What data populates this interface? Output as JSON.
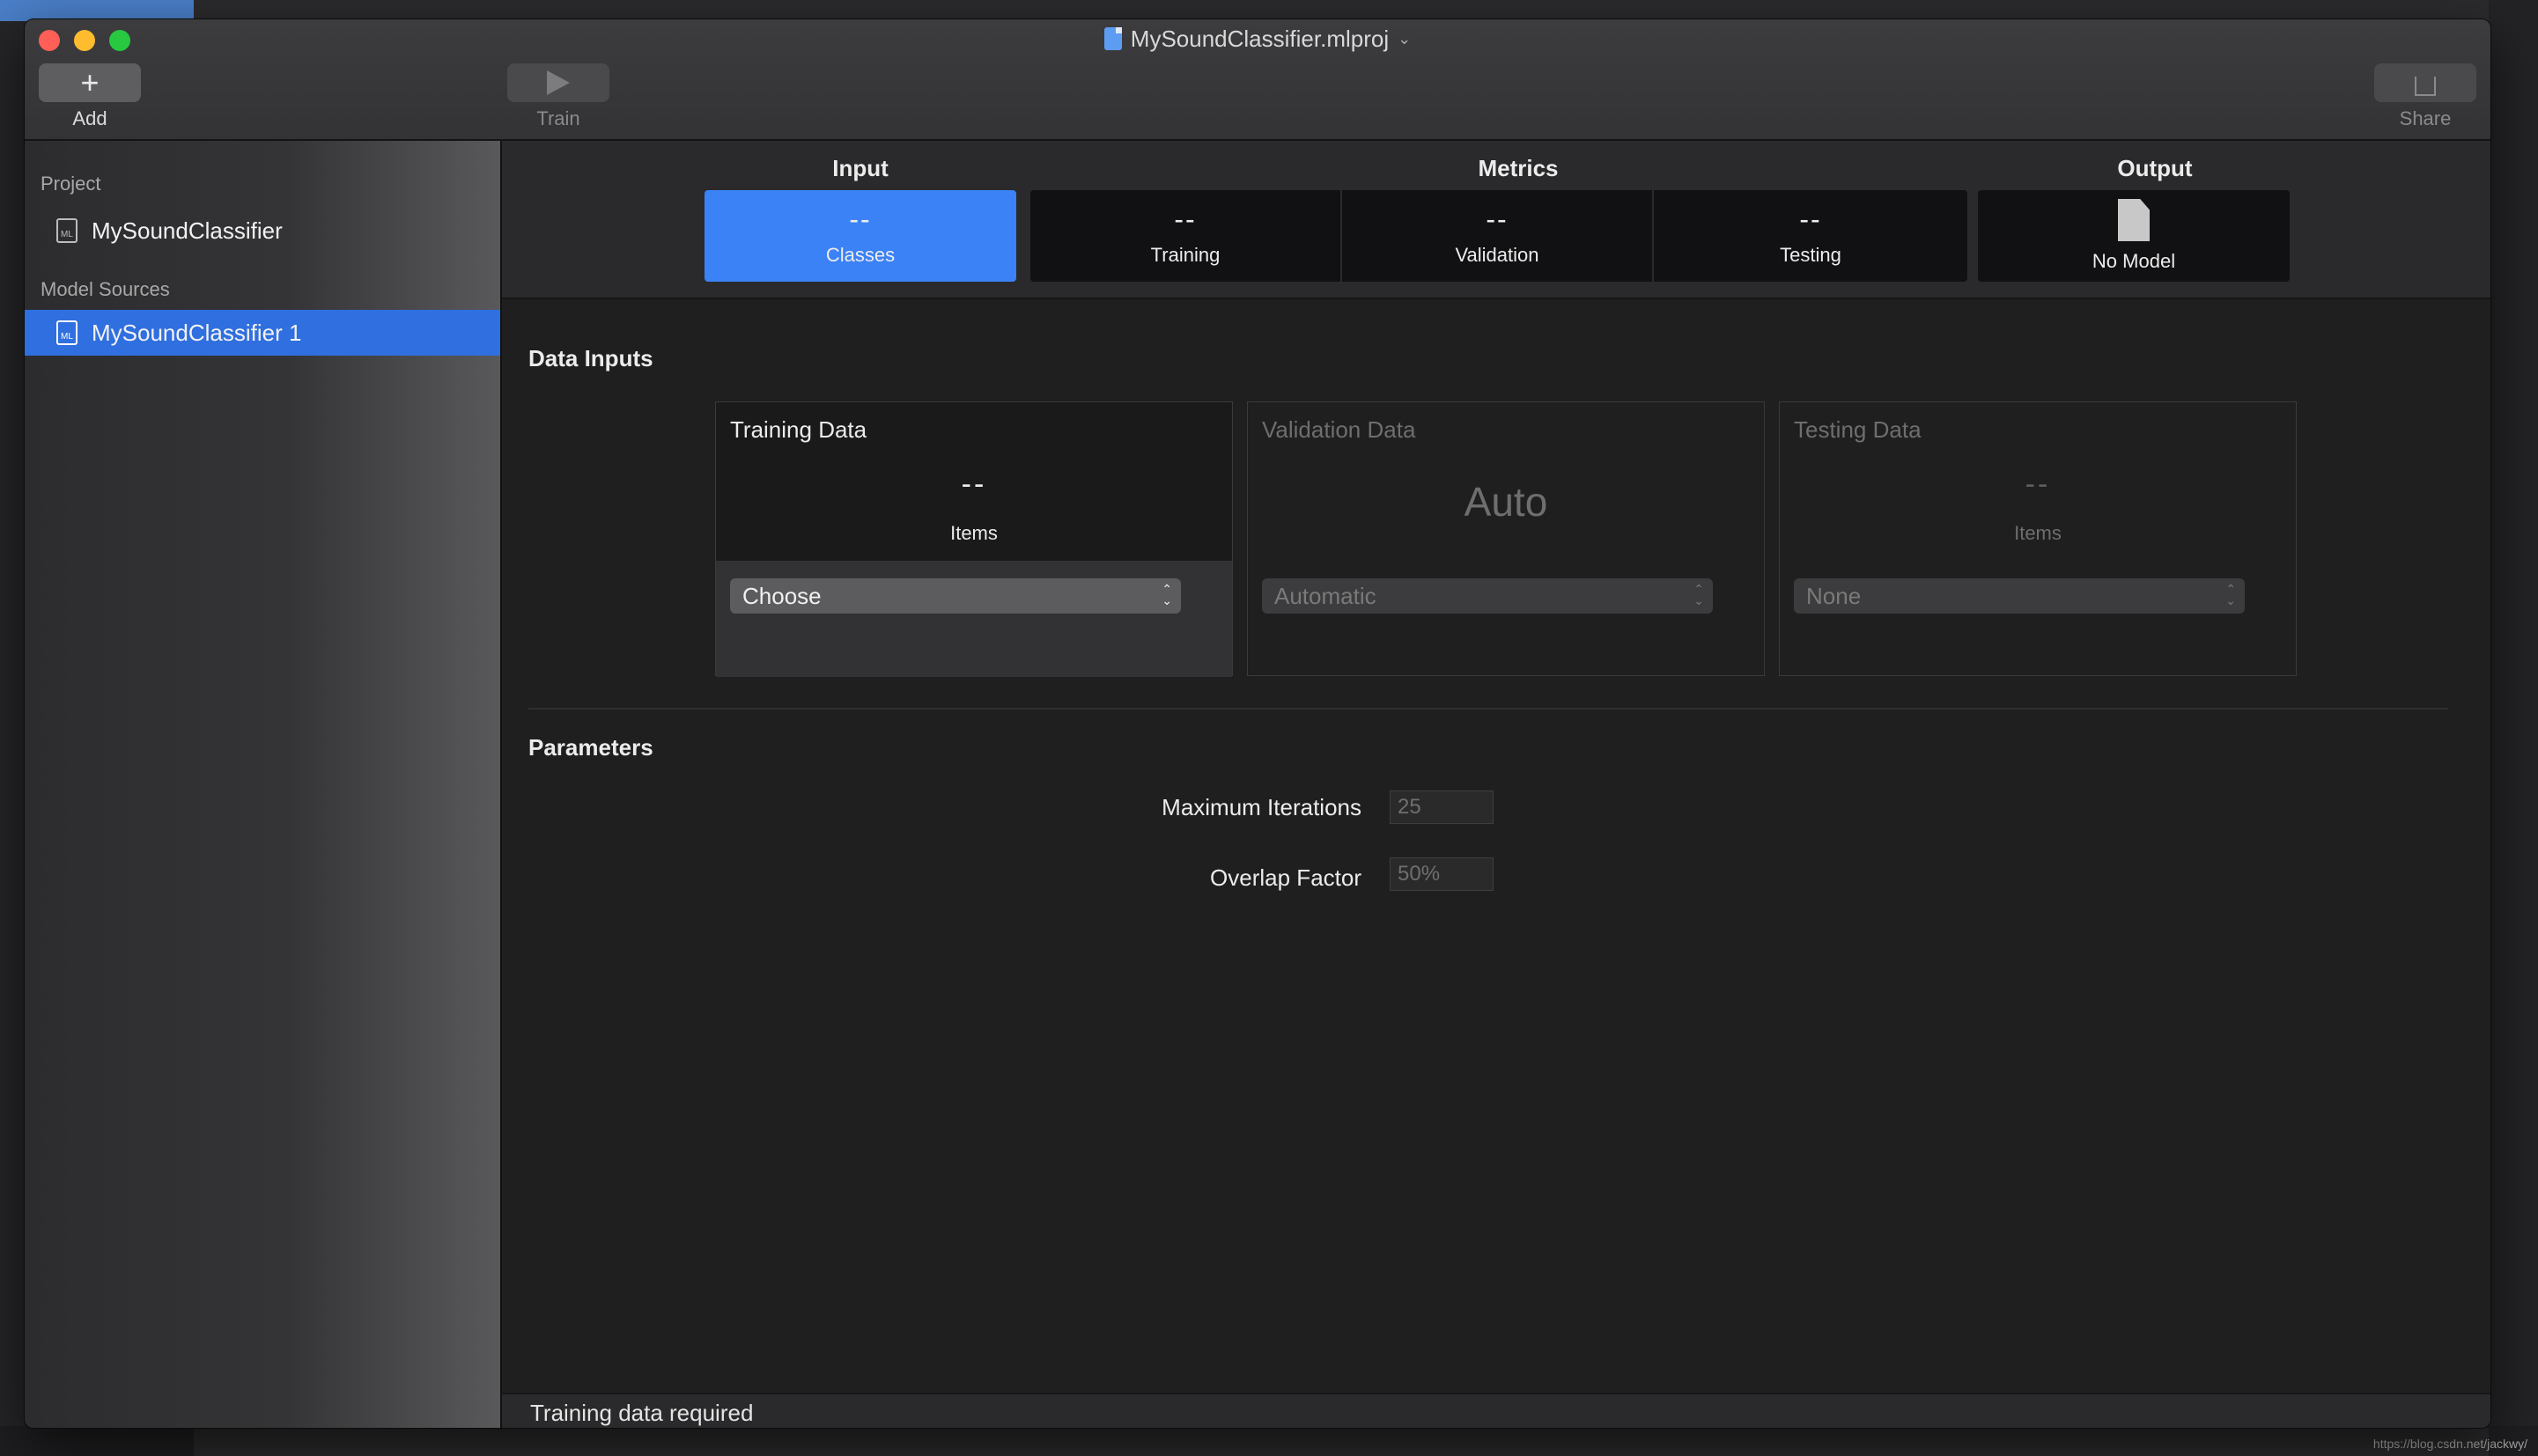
{
  "window": {
    "title": "MySoundClassifier.mlproj"
  },
  "toolbar": {
    "add_glyph": "+",
    "add_label": "Add",
    "train_label": "Train",
    "share_label": "Share"
  },
  "sidebar": {
    "project_header": "Project",
    "project_item": "MySoundClassifier",
    "sources_header": "Model Sources",
    "sources_item": "MySoundClassifier 1",
    "file_badge": "ML"
  },
  "tabs": {
    "input_header": "Input",
    "metrics_header": "Metrics",
    "output_header": "Output",
    "classes": {
      "value": "--",
      "label": "Classes"
    },
    "training": {
      "value": "--",
      "label": "Training"
    },
    "validation": {
      "value": "--",
      "label": "Validation"
    },
    "testing": {
      "value": "--",
      "label": "Testing"
    },
    "output": {
      "label": "No Model"
    }
  },
  "data_inputs": {
    "title": "Data Inputs",
    "training": {
      "title": "Training Data",
      "count": "--",
      "items_label": "Items",
      "select": "Choose"
    },
    "validation": {
      "title": "Validation Data",
      "value": "Auto",
      "select": "Automatic"
    },
    "testing": {
      "title": "Testing Data",
      "count": "--",
      "items_label": "Items",
      "select": "None"
    }
  },
  "parameters": {
    "title": "Parameters",
    "max_iterations_label": "Maximum Iterations",
    "max_iterations_value": "25",
    "overlap_label": "Overlap Factor",
    "overlap_value": "50%"
  },
  "status": {
    "text": "Training data required"
  },
  "watermark": "https://blog.csdn.net/jackwy/"
}
